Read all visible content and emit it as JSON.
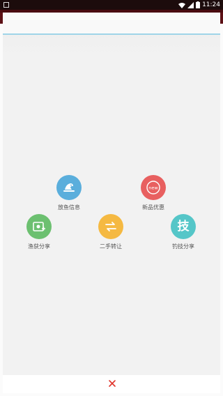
{
  "status_bar": {
    "time": "11:24"
  },
  "menu": {
    "items": [
      {
        "label": "放鱼信息",
        "color": "#5aaedc",
        "icon": "fish-release-icon"
      },
      {
        "label": "新品优惠",
        "color": "#e86060",
        "icon": "new-badge-icon"
      },
      {
        "label": "渔获分享",
        "color": "#6cc070",
        "icon": "photo-share-icon"
      },
      {
        "label": "二手转让",
        "color": "#f5b942",
        "icon": "exchange-icon"
      },
      {
        "label": "钓技分享",
        "color": "#55c6c8",
        "icon": "skill-icon"
      }
    ],
    "new_badge_text": "new",
    "skill_char": "技"
  },
  "close": {
    "symbol": "✕",
    "color": "#e0352b"
  }
}
